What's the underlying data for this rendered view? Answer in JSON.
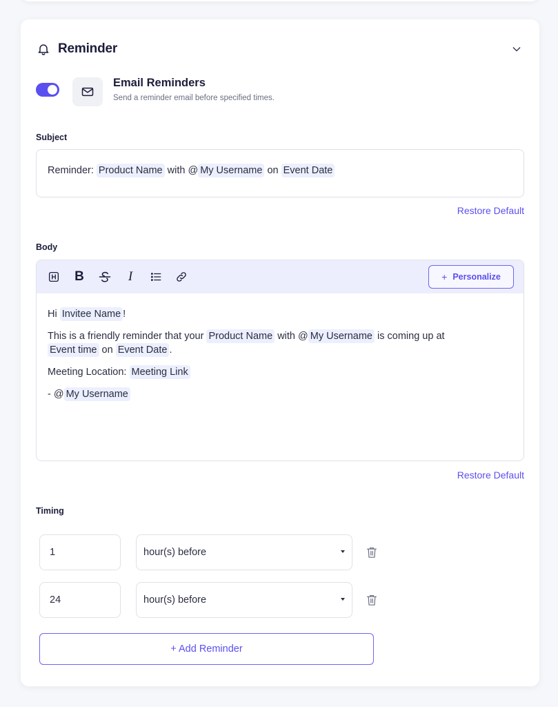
{
  "section": {
    "title": "Reminder",
    "icons": {
      "bell": "bell-icon",
      "collapse": "chevron-down-icon"
    }
  },
  "email_reminders": {
    "enabled": true,
    "title": "Email Reminders",
    "description": "Send a reminder email before specified times.",
    "icon": "mail-icon"
  },
  "subject": {
    "label": "Subject",
    "prefix": "Reminder: ",
    "chip_product": "Product Name",
    "with": " with ",
    "at": "@",
    "chip_username": "My Username",
    "on": " on ",
    "chip_date": "Event Date",
    "restore_label": "Restore Default"
  },
  "body": {
    "label": "Body",
    "personalize_plus": "+",
    "personalize_label": "Personalize",
    "line1_hi": "Hi ",
    "line1_chip": "Invitee Name",
    "line1_end": "!",
    "line2_a": "This is a friendly reminder that your ",
    "line2_chip_product": "Product Name",
    "line2_with": " with ",
    "line2_at": "@",
    "line2_chip_user": "My Username",
    "line2_b": " is coming up at",
    "line2_chip_time": "Event time",
    "line2_on": " on ",
    "line2_chip_date": "Event Date",
    "line2_end": ".",
    "line3_a": "Meeting Location: ",
    "line3_chip": "Meeting Link",
    "line4_a": "- ",
    "line4_at": "@",
    "line4_chip": "My Username",
    "restore_label": "Restore Default"
  },
  "timing": {
    "label": "Timing",
    "rows": [
      {
        "value": "1",
        "unit": "hour(s) before"
      },
      {
        "value": "24",
        "unit": "hour(s) before"
      }
    ],
    "add_label": "+ Add Reminder"
  },
  "colors": {
    "accent": "#5b4ff0",
    "chip_bg": "#eceffd",
    "toolbar_bg": "#eceefd"
  }
}
